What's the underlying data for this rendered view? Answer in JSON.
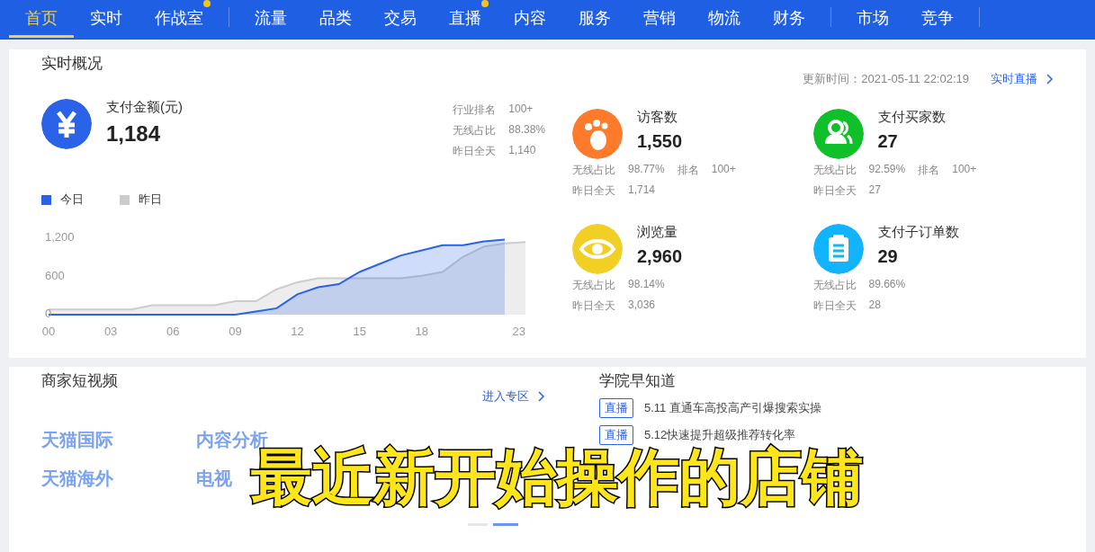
{
  "nav": [
    {
      "label": "首页",
      "selected": true,
      "dot": false,
      "divider_after": false
    },
    {
      "label": "实时",
      "selected": false,
      "dot": false,
      "divider_after": false
    },
    {
      "label": "作战室",
      "selected": false,
      "dot": true,
      "divider_after": true
    },
    {
      "label": "流量",
      "selected": false,
      "dot": false,
      "divider_after": false
    },
    {
      "label": "品类",
      "selected": false,
      "dot": false,
      "divider_after": false
    },
    {
      "label": "交易",
      "selected": false,
      "dot": false,
      "divider_after": false
    },
    {
      "label": "直播",
      "selected": false,
      "dot": true,
      "divider_after": false
    },
    {
      "label": "内容",
      "selected": false,
      "dot": false,
      "divider_after": false
    },
    {
      "label": "服务",
      "selected": false,
      "dot": false,
      "divider_after": false
    },
    {
      "label": "营销",
      "selected": false,
      "dot": false,
      "divider_after": false
    },
    {
      "label": "物流",
      "selected": false,
      "dot": false,
      "divider_after": false
    },
    {
      "label": "财务",
      "selected": false,
      "dot": false,
      "divider_after": true
    },
    {
      "label": "市场",
      "selected": false,
      "dot": false,
      "divider_after": false
    },
    {
      "label": "竞争",
      "selected": false,
      "dot": false,
      "divider_after": true
    }
  ],
  "overview": {
    "title": "实时概况",
    "update_time": "更新时间：2021-05-11 22:02:19",
    "live_link": "实时直播",
    "main": {
      "title": "支付金额(元)",
      "value": "1,184",
      "stats": [
        {
          "label": "行业排名",
          "value": "100+"
        },
        {
          "label": "无线占比",
          "value": "88.38%"
        },
        {
          "label": "昨日全天",
          "value": "1,140"
        }
      ],
      "chart_data": {
        "type": "area",
        "x": [
          0,
          1,
          2,
          3,
          4,
          5,
          6,
          7,
          8,
          9,
          10,
          11,
          12,
          13,
          14,
          15,
          16,
          17,
          18,
          19,
          20,
          21,
          22,
          23
        ],
        "series": [
          {
            "name": "今日",
            "color": "#2a62e8",
            "values": [
              0,
              0,
              0,
              0,
              0,
              0,
              0,
              0,
              0,
              0,
              50,
              100,
              320,
              430,
              480,
              670,
              800,
              930,
              1010,
              1090,
              1090,
              1150,
              1180,
              null
            ]
          },
          {
            "name": "昨日",
            "color": "#cccccc",
            "values": [
              80,
              80,
              80,
              80,
              80,
              150,
              150,
              150,
              150,
              210,
              210,
              400,
              510,
              570,
              570,
              570,
              570,
              570,
              610,
              670,
              910,
              1070,
              1120,
              1140
            ]
          }
        ],
        "xlim": [
          0,
          23
        ],
        "xticks": [
          {
            "value": 0,
            "label": "00"
          },
          {
            "value": 3,
            "label": "03"
          },
          {
            "value": 6,
            "label": "06"
          },
          {
            "value": 9,
            "label": "09"
          },
          {
            "value": 12,
            "label": "12"
          },
          {
            "value": 15,
            "label": "15"
          },
          {
            "value": 18,
            "label": "18"
          },
          {
            "value": 23,
            "label": "23"
          }
        ],
        "yticks": [
          {
            "value": 0,
            "label": "0"
          },
          {
            "value": 600,
            "label": "600"
          },
          {
            "value": 1200,
            "label": "1,200"
          }
        ],
        "ylim": [
          0,
          1200
        ]
      }
    },
    "metrics": [
      {
        "kind": "footprint",
        "color": "#ff7a2a",
        "title": "访客数",
        "value": "1,550",
        "rows": [
          [
            {
              "label": "无线占比",
              "value": "98.77%"
            },
            {
              "label": "排名",
              "value": "100+"
            }
          ],
          [
            {
              "label": "昨日全天",
              "value": "1,714"
            }
          ]
        ]
      },
      {
        "kind": "people",
        "color": "#10c02a",
        "title": "支付买家数",
        "value": "27",
        "rows": [
          [
            {
              "label": "无线占比",
              "value": "92.59%"
            },
            {
              "label": "排名",
              "value": "100+"
            }
          ],
          [
            {
              "label": "昨日全天",
              "value": "27"
            }
          ]
        ]
      },
      {
        "kind": "eye",
        "color": "#f2cf24",
        "title": "浏览量",
        "value": "2,960",
        "rows": [
          [
            {
              "label": "无线占比",
              "value": "98.14%"
            }
          ],
          [
            {
              "label": "昨日全天",
              "value": "3,036"
            }
          ]
        ]
      },
      {
        "kind": "clipboard",
        "color": "#12b3ff",
        "title": "支付子订单数",
        "value": "29",
        "rows": [
          [
            {
              "label": "无线占比",
              "value": "89.66%"
            }
          ],
          [
            {
              "label": "昨日全天",
              "value": "28"
            }
          ]
        ]
      }
    ]
  },
  "videos": {
    "title": "商家短视频",
    "link": "进入专区",
    "items": [
      "天猫国际",
      "内容分析",
      "天猫海外",
      "电视"
    ],
    "pager": [
      {
        "selected": false
      },
      {
        "selected": true
      }
    ]
  },
  "academy": {
    "title": "学院早知道",
    "items": [
      {
        "tag": "直播",
        "text": "5.11 直通车高投高产引爆搜索实操"
      },
      {
        "tag": "直播",
        "text": "5.12快速提升超级推荐转化率"
      }
    ]
  },
  "caption": "最近新开始操作的店铺"
}
